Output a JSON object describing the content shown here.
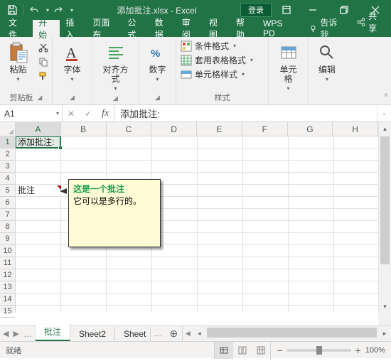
{
  "titlebar": {
    "filename": "添加批注.xlsx - Excel",
    "login": "登录"
  },
  "tabs": {
    "file": "文件",
    "home": "开始",
    "insert": "插入",
    "pageLayout": "页面布",
    "formulas": "公式",
    "data": "数据",
    "review": "审阅",
    "view": "视图",
    "help": "帮助",
    "wps": "WPS PD",
    "tellme": "告诉我",
    "share": "共享"
  },
  "ribbon": {
    "clipboard": {
      "paste": "粘贴",
      "label": "剪贴板"
    },
    "font": {
      "label": "字体"
    },
    "alignment": {
      "label": "对齐方式"
    },
    "number": {
      "label": "数字"
    },
    "styles": {
      "conditional": "条件格式",
      "tableformat": "套用表格格式",
      "cellstyle": "单元格样式",
      "label": "样式"
    },
    "cells": {
      "label": "单元格"
    },
    "editing": {
      "label": "编辑"
    }
  },
  "namebox": "A1",
  "formula": "添加批注:",
  "columns": [
    "A",
    "B",
    "C",
    "D",
    "E",
    "F",
    "G",
    "H"
  ],
  "rows": [
    "1",
    "2",
    "3",
    "4",
    "5",
    "6",
    "7",
    "8",
    "9",
    "10",
    "11",
    "12",
    "13",
    "14",
    "15"
  ],
  "cellsData": {
    "A1": "添加批注:",
    "A5": "批注"
  },
  "comment": {
    "author": "这是一个批注",
    "body": "它可以是多行的。"
  },
  "sheets": {
    "s1": "批注",
    "s2": "Sheet2",
    "s3": "Sheet",
    "dots": "…"
  },
  "status": {
    "ready": "就绪",
    "zoom": "100%"
  }
}
